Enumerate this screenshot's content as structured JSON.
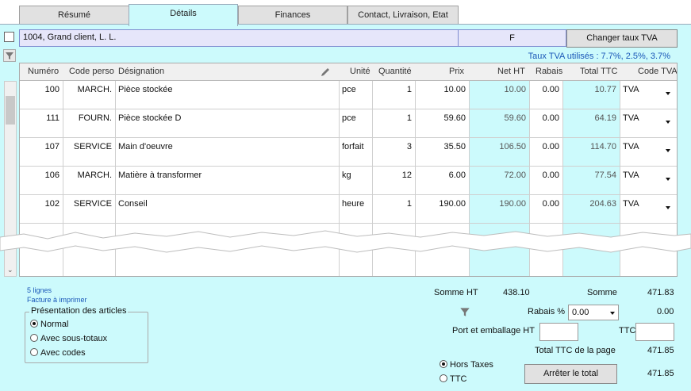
{
  "tabs": [
    {
      "label": "Résumé"
    },
    {
      "label": "Détails"
    },
    {
      "label": "Finances"
    },
    {
      "label": "Contact, Livraison, Etat"
    }
  ],
  "header": {
    "client": "1004, Grand client, L. L.",
    "code": "F",
    "change_tva_label": "Changer taux TVA",
    "tva_used": "Taux TVA utilisés : 7.7%, 2.5%, 3.7%"
  },
  "grid": {
    "columns": [
      "Numéro",
      "Code perso",
      "Désignation",
      "Unité",
      "Quantité",
      "Prix",
      "Net HT",
      "Rabais",
      "Total TTC",
      "Code TVA"
    ],
    "rows": [
      {
        "numero": "100",
        "code": "MARCH.",
        "designation": "Pièce stockée",
        "unite": "pce",
        "quantite": "1",
        "prix": "10.00",
        "net": "10.00",
        "rabais": "0.00",
        "total": "10.77",
        "tva": "TVA"
      },
      {
        "numero": "111",
        "code": "FOURN.",
        "designation": "Pièce stockée D",
        "unite": "pce",
        "quantite": "1",
        "prix": "59.60",
        "net": "59.60",
        "rabais": "0.00",
        "total": "64.19",
        "tva": "TVA"
      },
      {
        "numero": "107",
        "code": "SERVICE",
        "designation": "Main d'oeuvre",
        "unite": "forfait",
        "quantite": "3",
        "prix": "35.50",
        "net": "106.50",
        "rabais": "0.00",
        "total": "114.70",
        "tva": "TVA"
      },
      {
        "numero": "106",
        "code": "MARCH.",
        "designation": "Matière à transformer",
        "unite": "kg",
        "quantite": "12",
        "prix": "6.00",
        "net": "72.00",
        "rabais": "0.00",
        "total": "77.54",
        "tva": "TVA"
      },
      {
        "numero": "102",
        "code": "SERVICE",
        "designation": "Conseil",
        "unite": "heure",
        "quantite": "1",
        "prix": "190.00",
        "net": "190.00",
        "rabais": "0.00",
        "total": "204.63",
        "tva": "TVA"
      }
    ]
  },
  "footer": {
    "lines_count": "5 lignes",
    "print_link": "Facture à imprimer",
    "presentation_title": "Présentation des articles",
    "presentation_options": [
      "Normal",
      "Avec sous-totaux",
      "Avec codes"
    ],
    "somme_ht_label": "Somme HT",
    "somme_ht_value": "438.10",
    "somme_label": "Somme",
    "somme_value": "471.83",
    "rabais_label": "Rabais %",
    "rabais_select": "0.00",
    "rabais_value": "0.00",
    "port_label": "Port et emballage HT",
    "ttc_label": "TTC",
    "total_page_label": "Total TTC de la page",
    "total_page_value": "471.85",
    "mode_options": [
      "Hors Taxes",
      "TTC"
    ],
    "stop_total_label": "Arrêter le total",
    "stop_total_value": "471.85"
  },
  "colors": {
    "panel": "#ccfafc",
    "accent_text": "#1a57b8",
    "client_bg": "#e6e6fa"
  },
  "icons": [
    "filter-icon",
    "pencil-icon",
    "dropdown-arrow-icon",
    "radio-icon",
    "checkbox-icon"
  ]
}
